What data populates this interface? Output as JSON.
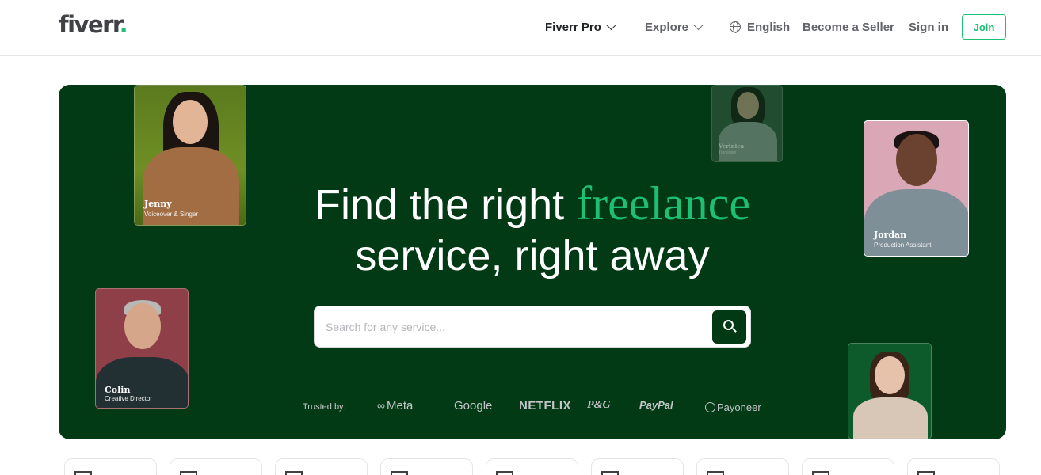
{
  "header": {
    "logo": "fiverr",
    "logo_dot": ".",
    "nav": {
      "fiverr_pro": "Fiverr Pro",
      "explore": "Explore",
      "language": "English",
      "become_seller": "Become a Seller",
      "sign_in": "Sign in",
      "join": "Join"
    },
    "icons": [
      "chevron-down-icon",
      "globe-icon"
    ]
  },
  "hero": {
    "headline_line1_prefix": "Find the right",
    "headline_line1_accent": "freelance",
    "headline_line2": "service, right away",
    "search": {
      "placeholder": "Search for any service..."
    },
    "trusted_label": "Trusted by:",
    "brands": [
      "Meta",
      "Google",
      "NETFLIX",
      "P&G",
      "PayPal",
      "Payoneer"
    ],
    "profiles": [
      {
        "name": "Jenny",
        "role": "Voiceover & Singer"
      },
      {
        "name": "Verinica",
        "role": "Translator"
      },
      {
        "name": "Jordan",
        "role": "Production Assistant"
      },
      {
        "name": "Colin",
        "role": "Creative Director"
      }
    ]
  },
  "colors": {
    "brand_green": "#1dbf73",
    "hero_bg": "#023a15",
    "search_button": "#013914"
  }
}
